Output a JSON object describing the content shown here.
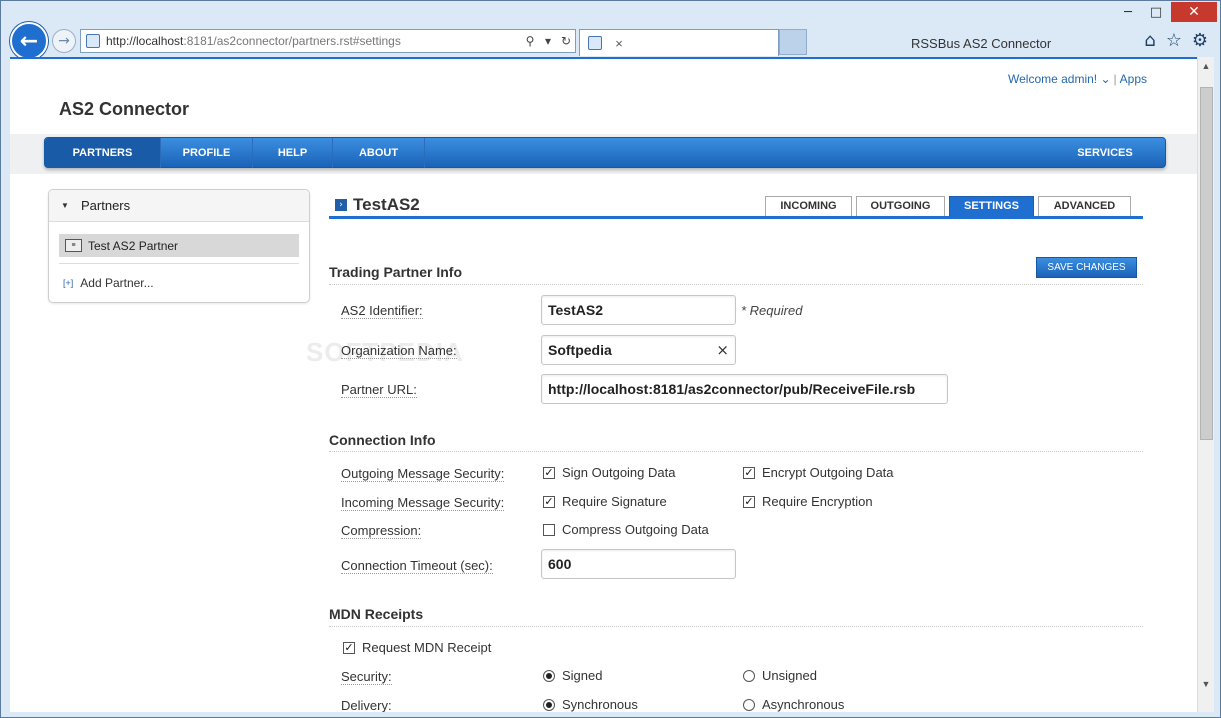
{
  "browser": {
    "url_host": "http://localhost",
    "url_rest": ":8181/as2connector/partners.rst#settings",
    "tab_title": "RSSBus AS2 Connector",
    "tab_close": "×",
    "window_min": "─",
    "window_max": "□",
    "window_close": "✕",
    "back_glyph": "←",
    "forward_glyph": "→"
  },
  "header": {
    "welcome": "Welcome admin! ⌄",
    "separator": "|",
    "apps": "Apps",
    "app_title": "AS2 Connector"
  },
  "nav": {
    "items": [
      "PARTNERS",
      "PROFILE",
      "HELP",
      "ABOUT"
    ],
    "services": "SERVICES",
    "active": "PARTNERS"
  },
  "sidebar": {
    "title": "Partners",
    "partner": "Test AS2 Partner",
    "add_partner": "Add Partner...",
    "add_glyph": "[+]"
  },
  "main": {
    "partner_title": "TestAS2",
    "tabs": [
      "INCOMING",
      "OUTGOING",
      "SETTINGS",
      "ADVANCED"
    ],
    "active_tab": "SETTINGS",
    "save_label": "SAVE CHANGES",
    "watermark": "SOFTPEDIA"
  },
  "trading": {
    "heading": "Trading Partner Info",
    "as2_id_label": "AS2 Identifier:",
    "as2_id_value": "TestAS2",
    "required": "* Required",
    "org_label": "Organization Name:",
    "org_value": "Softpedia",
    "clear_glyph": "×",
    "url_label": "Partner URL:",
    "url_value": "http://localhost:8181/as2connector/pub/ReceiveFile.rsb"
  },
  "connection": {
    "heading": "Connection Info",
    "outgoing_label": "Outgoing Message Security:",
    "sign_outgoing": "Sign Outgoing Data",
    "encrypt_outgoing": "Encrypt Outgoing Data",
    "incoming_label": "Incoming Message Security:",
    "require_signature": "Require Signature",
    "require_encryption": "Require Encryption",
    "compression_label": "Compression:",
    "compress_outgoing": "Compress Outgoing Data",
    "timeout_label": "Connection Timeout (sec):",
    "timeout_value": "600",
    "checked": {
      "sign_outgoing": true,
      "encrypt_outgoing": true,
      "require_signature": true,
      "require_encryption": true,
      "compress_outgoing": false
    }
  },
  "mdn": {
    "heading": "MDN Receipts",
    "request_receipt": "Request MDN Receipt",
    "request_checked": true,
    "security_label": "Security:",
    "signed": "Signed",
    "unsigned": "Unsigned",
    "security_value": "Signed",
    "delivery_label": "Delivery:",
    "synchronous": "Synchronous",
    "asynchronous": "Asynchronous",
    "delivery_value": "Synchronous"
  },
  "colors": {
    "accent": "#1f6fd1",
    "nav_dark": "#1a5ba8"
  }
}
